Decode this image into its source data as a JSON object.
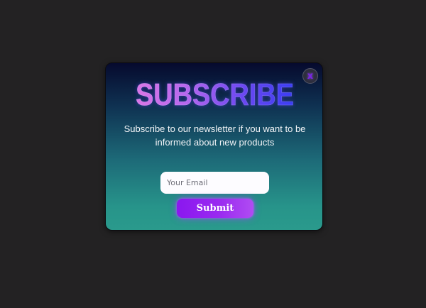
{
  "modal": {
    "title": "SUBSCRIBE",
    "subtitle": "Subscribe to our newsletter if you want to be informed about new products",
    "close_label": "x",
    "email_placeholder": "Your Email",
    "email_value": "",
    "submit_label": "Submit",
    "close_icon": "close-x-icon"
  },
  "colors": {
    "page_background": "#232223",
    "modal_gradient_top": "#060a2e",
    "modal_gradient_bottom": "#2a9a8c",
    "title_gradient_start": "#e47be6",
    "title_gradient_end": "#2d3af3",
    "button_purple": "#8a17ef",
    "close_icon": "#7a22e6"
  }
}
